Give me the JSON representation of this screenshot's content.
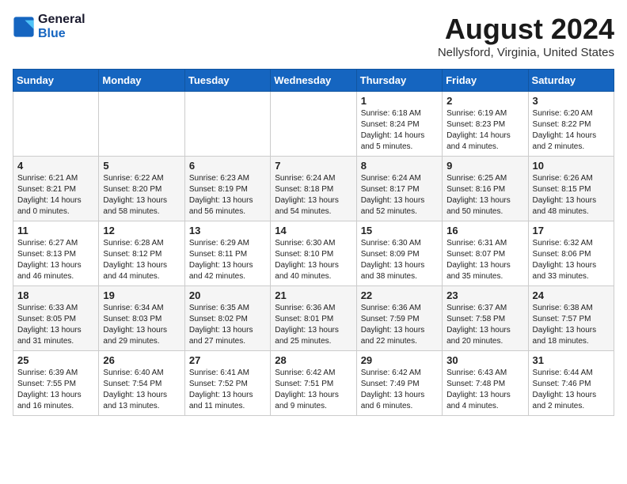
{
  "logo": {
    "line1": "General",
    "line2": "Blue"
  },
  "title": {
    "month_year": "August 2024",
    "location": "Nellysford, Virginia, United States"
  },
  "days_of_week": [
    "Sunday",
    "Monday",
    "Tuesday",
    "Wednesday",
    "Thursday",
    "Friday",
    "Saturday"
  ],
  "weeks": [
    [
      {
        "day": "",
        "info": ""
      },
      {
        "day": "",
        "info": ""
      },
      {
        "day": "",
        "info": ""
      },
      {
        "day": "",
        "info": ""
      },
      {
        "day": "1",
        "info": "Sunrise: 6:18 AM\nSunset: 8:24 PM\nDaylight: 14 hours\nand 5 minutes."
      },
      {
        "day": "2",
        "info": "Sunrise: 6:19 AM\nSunset: 8:23 PM\nDaylight: 14 hours\nand 4 minutes."
      },
      {
        "day": "3",
        "info": "Sunrise: 6:20 AM\nSunset: 8:22 PM\nDaylight: 14 hours\nand 2 minutes."
      }
    ],
    [
      {
        "day": "4",
        "info": "Sunrise: 6:21 AM\nSunset: 8:21 PM\nDaylight: 14 hours\nand 0 minutes."
      },
      {
        "day": "5",
        "info": "Sunrise: 6:22 AM\nSunset: 8:20 PM\nDaylight: 13 hours\nand 58 minutes."
      },
      {
        "day": "6",
        "info": "Sunrise: 6:23 AM\nSunset: 8:19 PM\nDaylight: 13 hours\nand 56 minutes."
      },
      {
        "day": "7",
        "info": "Sunrise: 6:24 AM\nSunset: 8:18 PM\nDaylight: 13 hours\nand 54 minutes."
      },
      {
        "day": "8",
        "info": "Sunrise: 6:24 AM\nSunset: 8:17 PM\nDaylight: 13 hours\nand 52 minutes."
      },
      {
        "day": "9",
        "info": "Sunrise: 6:25 AM\nSunset: 8:16 PM\nDaylight: 13 hours\nand 50 minutes."
      },
      {
        "day": "10",
        "info": "Sunrise: 6:26 AM\nSunset: 8:15 PM\nDaylight: 13 hours\nand 48 minutes."
      }
    ],
    [
      {
        "day": "11",
        "info": "Sunrise: 6:27 AM\nSunset: 8:13 PM\nDaylight: 13 hours\nand 46 minutes."
      },
      {
        "day": "12",
        "info": "Sunrise: 6:28 AM\nSunset: 8:12 PM\nDaylight: 13 hours\nand 44 minutes."
      },
      {
        "day": "13",
        "info": "Sunrise: 6:29 AM\nSunset: 8:11 PM\nDaylight: 13 hours\nand 42 minutes."
      },
      {
        "day": "14",
        "info": "Sunrise: 6:30 AM\nSunset: 8:10 PM\nDaylight: 13 hours\nand 40 minutes."
      },
      {
        "day": "15",
        "info": "Sunrise: 6:30 AM\nSunset: 8:09 PM\nDaylight: 13 hours\nand 38 minutes."
      },
      {
        "day": "16",
        "info": "Sunrise: 6:31 AM\nSunset: 8:07 PM\nDaylight: 13 hours\nand 35 minutes."
      },
      {
        "day": "17",
        "info": "Sunrise: 6:32 AM\nSunset: 8:06 PM\nDaylight: 13 hours\nand 33 minutes."
      }
    ],
    [
      {
        "day": "18",
        "info": "Sunrise: 6:33 AM\nSunset: 8:05 PM\nDaylight: 13 hours\nand 31 minutes."
      },
      {
        "day": "19",
        "info": "Sunrise: 6:34 AM\nSunset: 8:03 PM\nDaylight: 13 hours\nand 29 minutes."
      },
      {
        "day": "20",
        "info": "Sunrise: 6:35 AM\nSunset: 8:02 PM\nDaylight: 13 hours\nand 27 minutes."
      },
      {
        "day": "21",
        "info": "Sunrise: 6:36 AM\nSunset: 8:01 PM\nDaylight: 13 hours\nand 25 minutes."
      },
      {
        "day": "22",
        "info": "Sunrise: 6:36 AM\nSunset: 7:59 PM\nDaylight: 13 hours\nand 22 minutes."
      },
      {
        "day": "23",
        "info": "Sunrise: 6:37 AM\nSunset: 7:58 PM\nDaylight: 13 hours\nand 20 minutes."
      },
      {
        "day": "24",
        "info": "Sunrise: 6:38 AM\nSunset: 7:57 PM\nDaylight: 13 hours\nand 18 minutes."
      }
    ],
    [
      {
        "day": "25",
        "info": "Sunrise: 6:39 AM\nSunset: 7:55 PM\nDaylight: 13 hours\nand 16 minutes."
      },
      {
        "day": "26",
        "info": "Sunrise: 6:40 AM\nSunset: 7:54 PM\nDaylight: 13 hours\nand 13 minutes."
      },
      {
        "day": "27",
        "info": "Sunrise: 6:41 AM\nSunset: 7:52 PM\nDaylight: 13 hours\nand 11 minutes."
      },
      {
        "day": "28",
        "info": "Sunrise: 6:42 AM\nSunset: 7:51 PM\nDaylight: 13 hours\nand 9 minutes."
      },
      {
        "day": "29",
        "info": "Sunrise: 6:42 AM\nSunset: 7:49 PM\nDaylight: 13 hours\nand 6 minutes."
      },
      {
        "day": "30",
        "info": "Sunrise: 6:43 AM\nSunset: 7:48 PM\nDaylight: 13 hours\nand 4 minutes."
      },
      {
        "day": "31",
        "info": "Sunrise: 6:44 AM\nSunset: 7:46 PM\nDaylight: 13 hours\nand 2 minutes."
      }
    ]
  ]
}
